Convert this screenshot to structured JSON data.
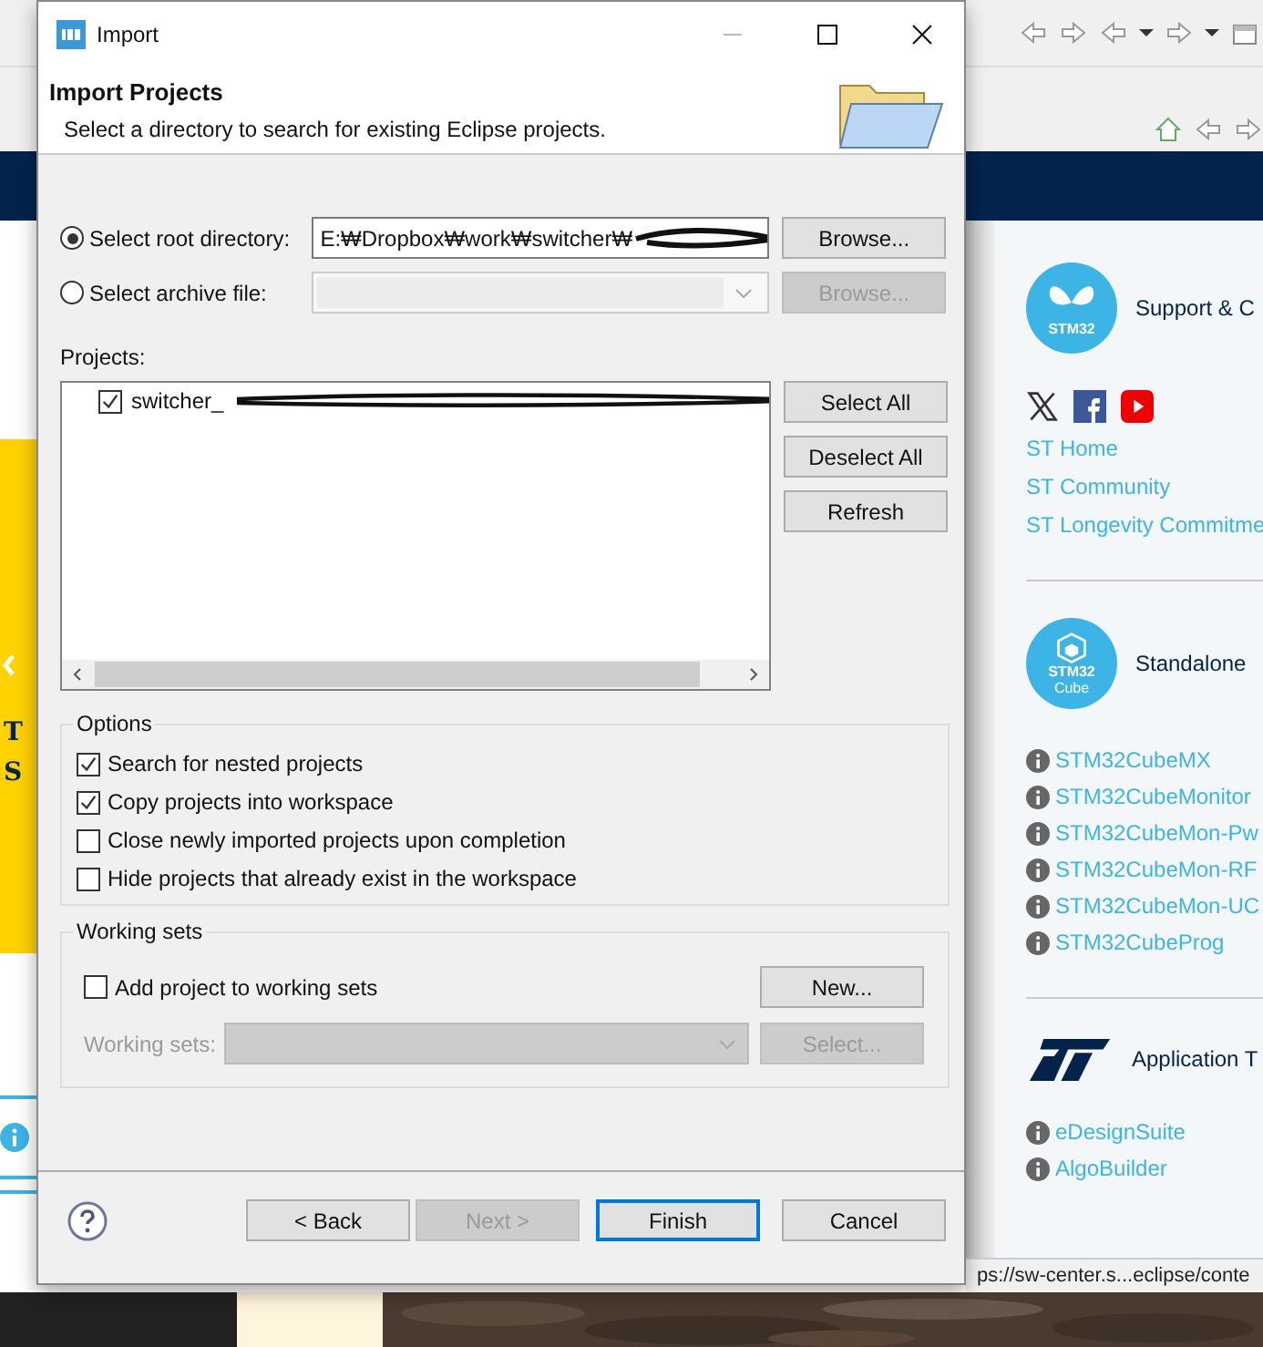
{
  "background": {
    "left_panel": {
      "texts": [
        "T",
        "S"
      ]
    },
    "right_panel": {
      "sections": [
        {
          "kind": "butterfly",
          "logo_text": "STM32",
          "title": "Support & C",
          "links": [
            "ST Home",
            "ST Community",
            "ST Longevity Commitme"
          ]
        },
        {
          "kind": "cube",
          "logo_text": "STM32",
          "logo_subtext": "Cube",
          "title": "Standalone",
          "links": [
            "STM32CubeMX",
            "STM32CubeMonitor",
            "STM32CubeMon-Pw",
            "STM32CubeMon-RF",
            "STM32CubeMon-UC",
            "STM32CubeProg"
          ]
        },
        {
          "kind": "st",
          "title": "Application T",
          "links": [
            "eDesignSuite",
            "AlgoBuilder"
          ]
        }
      ]
    },
    "status_url": "ps://sw-center.s...eclipse/conte"
  },
  "dialog": {
    "title": "Import",
    "header": {
      "title": "Import Projects",
      "subtitle": "Select a directory to search for existing Eclipse projects."
    },
    "sources": [
      {
        "kind": "text",
        "label": "Select root directory:",
        "selected": true,
        "disabled": false,
        "value": "E:₩Dropbox₩work₩switcher₩",
        "button": "Browse..."
      },
      {
        "kind": "combo",
        "label": "Select archive file:",
        "selected": false,
        "disabled": true,
        "button": "Browse..."
      }
    ],
    "projects_label": "Projects:",
    "projects": [
      {
        "label": "switcher_",
        "checked": true
      }
    ],
    "project_buttons": [
      "Select All",
      "Deselect All",
      "Refresh"
    ],
    "options": {
      "title": "Options",
      "items": [
        {
          "label": "Search for nested projects",
          "checked": true
        },
        {
          "label": "Copy projects into workspace",
          "checked": true
        },
        {
          "label": "Close newly imported projects upon completion",
          "checked": false
        },
        {
          "label": "Hide projects that already exist in the workspace",
          "checked": false
        }
      ]
    },
    "working_sets": {
      "title": "Working sets",
      "add": {
        "label": "Add project to working sets",
        "checked": false
      },
      "new_button": "New...",
      "field_label": "Working sets:",
      "disabled": true,
      "select_button": "Select..."
    },
    "buttons": [
      {
        "label": "< Back",
        "disabled": false,
        "default": false
      },
      {
        "label": "Next >",
        "disabled": true,
        "default": false
      },
      {
        "label": "Finish",
        "disabled": false,
        "default": true
      },
      {
        "label": "Cancel",
        "disabled": false,
        "default": false
      }
    ]
  }
}
